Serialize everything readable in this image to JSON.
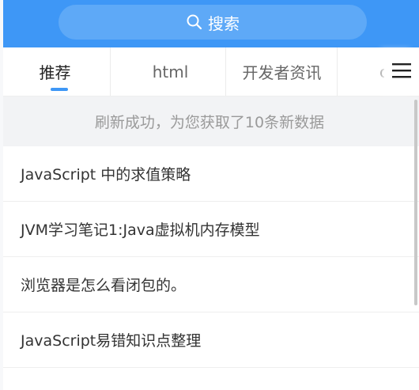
{
  "search": {
    "placeholder": "搜索",
    "icon": "search-icon"
  },
  "tabs": [
    {
      "label": "推荐",
      "active": true
    },
    {
      "label": "html",
      "active": false
    },
    {
      "label": "开发者资讯",
      "active": false
    },
    {
      "label": "c",
      "active": false
    }
  ],
  "menu": {
    "icon": "hamburger-menu-icon"
  },
  "refresh_banner": {
    "text": "刷新成功，为您获取了10条新数据"
  },
  "articles": [
    {
      "title": "JavaScript 中的求值策略"
    },
    {
      "title": "JVM学习笔记1:Java虚拟机内存模型"
    },
    {
      "title": "浏览器是怎么看闭包的。"
    },
    {
      "title": "JavaScript易错知识点整理"
    }
  ],
  "colors": {
    "header": "#3e97f6",
    "search_bg": "#5ea9f7",
    "active_indicator": "#3e97f6",
    "banner_bg": "#f2f3f5"
  }
}
